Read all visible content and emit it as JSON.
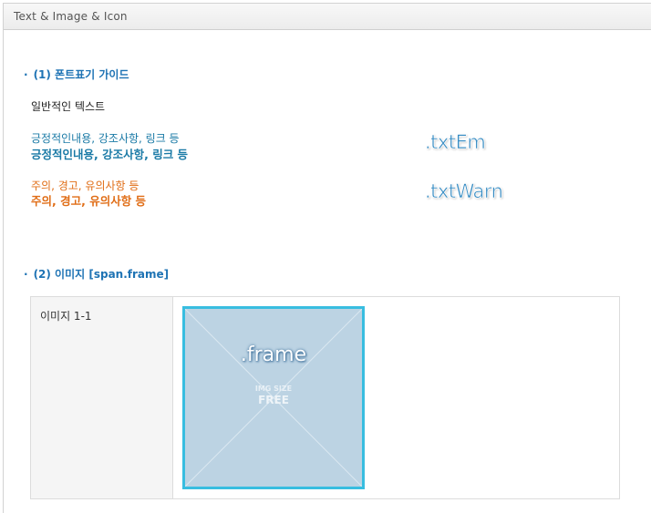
{
  "panel": {
    "title": "Text & Image & Icon"
  },
  "section1": {
    "bullet": "·",
    "title": "(1) 폰트표기 가이드",
    "normal_text": "일반적인 텍스트",
    "em_text": "긍정적인내용, 강조사항, 링크 등",
    "em_text_bold": "긍정적인내용, 강조사항, 링크 등",
    "em_class": ".txtEm",
    "warn_text": "주의, 경고, 유의사항 등",
    "warn_text_bold": "주의, 경고, 유의사항 등",
    "warn_class": ".txtWarn"
  },
  "section2": {
    "bullet": "·",
    "title": "(2) 이미지 [span.frame]",
    "row_label": "이미지 1-1",
    "frame_label": ".frame",
    "frame_sub": "IMG SIZE",
    "frame_sub2": "FREE"
  },
  "colors": {
    "em": "#1a7aa6",
    "warn": "#e06d16",
    "frame_border": "#38bde0",
    "frame_bg": "#bcd3e3"
  }
}
